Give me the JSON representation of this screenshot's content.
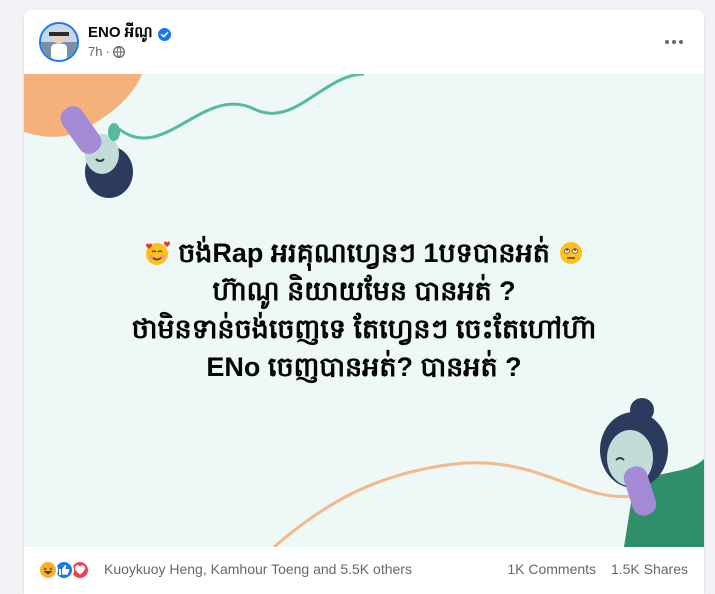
{
  "post": {
    "author": "ENO អីណូ",
    "time": "7h",
    "meta_separator": "·",
    "text_lines": [
      "ចង់Rap អរគុណហ្វេនៗ 1បទបានអត់",
      "ហ៊ាណូ និយាយមែន បានអត់ ?",
      "ថាមិនទាន់ចង់ចេញទេ តែហ្វេនៗ ចេះតែហៅហ៊ា",
      "ENo ចេញបានអត់? បានអត់ ?"
    ],
    "background_color": "#eef8f7"
  },
  "footer": {
    "reactors": "Kuoykuoy Heng, Kamhour Toeng and 5.5K others",
    "comments": "1K Comments",
    "shares": "1.5K Shares",
    "reaction_icons": [
      "haha-icon",
      "like-icon",
      "love-icon"
    ]
  },
  "colors": {
    "accent": "#1877f2",
    "text_secondary": "#65676b",
    "love": "#f33e58",
    "haha": "#f7b125"
  }
}
